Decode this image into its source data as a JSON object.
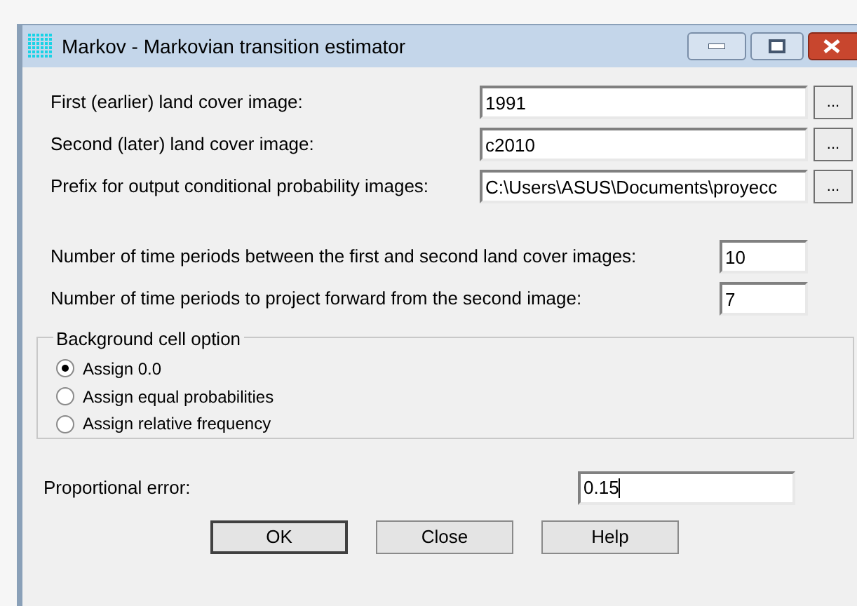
{
  "window": {
    "title": "Markov - Markovian transition estimator"
  },
  "file_fields": [
    {
      "label": "First (earlier) land cover image:",
      "value": "1991",
      "browse": "..."
    },
    {
      "label": "Second (later) land cover image:",
      "value": "c2010",
      "browse": "..."
    },
    {
      "label": "Prefix for output conditional probability images:",
      "value": "C:\\Users\\ASUS\\Documents\\proyecc",
      "browse": "..."
    }
  ],
  "period_fields": [
    {
      "label": "Number of time periods between the first and second land cover images:",
      "value": "10"
    },
    {
      "label": "Number of time periods to project forward from the second image:",
      "value": "7"
    }
  ],
  "background_option": {
    "title": "Background cell option",
    "options": [
      {
        "label": "Assign 0.0",
        "selected": true
      },
      {
        "label": "Assign equal probabilities",
        "selected": false
      },
      {
        "label": "Assign relative frequency",
        "selected": false
      }
    ]
  },
  "proportional_error": {
    "label": "Proportional error:",
    "value": "0.15",
    "focused": true
  },
  "buttons": [
    {
      "label": "OK",
      "default": true
    },
    {
      "label": "Close",
      "default": false
    },
    {
      "label": "Help",
      "default": false
    }
  ]
}
